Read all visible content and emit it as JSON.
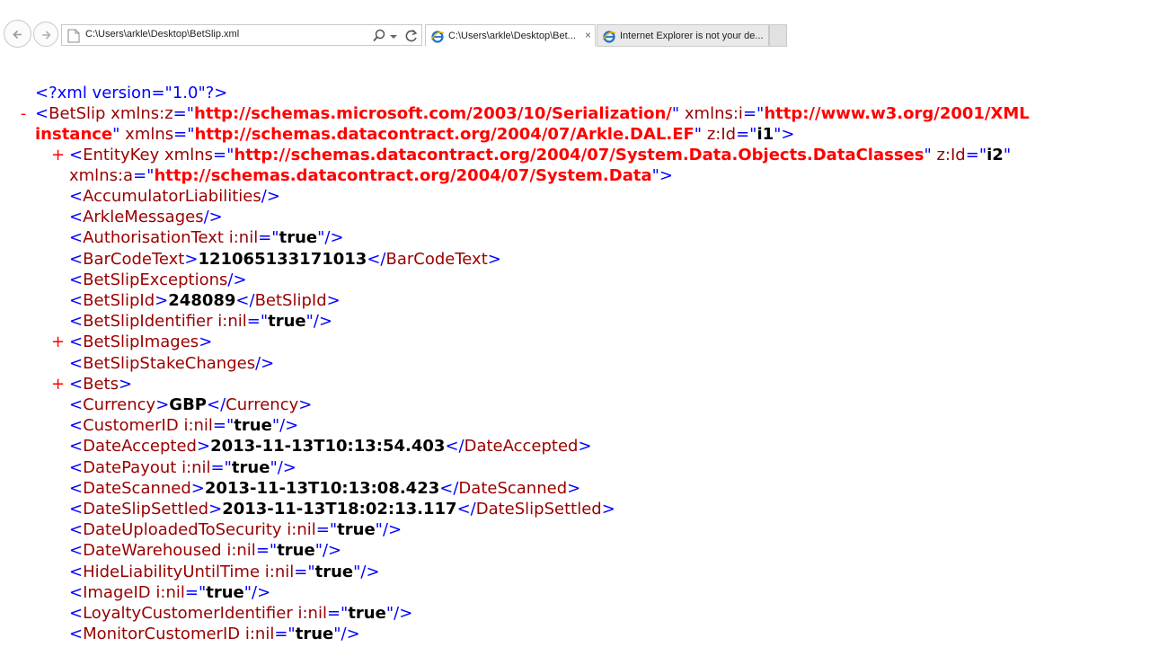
{
  "browser": {
    "address_url": "C:\\Users\\arkle\\Desktop\\BetSlip.xml",
    "tabs": [
      {
        "label": "C:\\Users\\arkle\\Desktop\\Bet...",
        "active": true
      },
      {
        "label": "Internet Explorer is not your de...",
        "active": false
      }
    ],
    "close_glyph": "×"
  },
  "xml": {
    "declaration": "<?xml version=\"1.0\"?>",
    "root": {
      "marker": "-",
      "name": "BetSlip",
      "attr1_name": "xmlns:z",
      "attr1_value": "http://schemas.microsoft.com/2003/10/Serialization/",
      "attr2_name": "xmlns:i",
      "attr2_value_a": "http://www.w3.org/2001/XML",
      "attr2_value_b": "instance",
      "attr3_name": "xmlns",
      "attr3_value": "http://schemas.datacontract.org/2004/07/Arkle.DAL.EF",
      "attr4_name": "z:Id",
      "attr4_value": "i1"
    },
    "entity_key": {
      "marker": "+",
      "name": "EntityKey",
      "attr1_name": "xmlns",
      "attr1_value": "http://schemas.datacontract.org/2004/07/System.Data.Objects.DataClasses",
      "attr2_name": "z:Id",
      "attr2_value": "i2",
      "attr3_name": "xmlns:a",
      "attr3_value": "http://schemas.datacontract.org/2004/07/System.Data"
    },
    "lines": [
      {
        "kind": "empty",
        "name": "AccumulatorLiabilities"
      },
      {
        "kind": "empty",
        "name": "ArkleMessages"
      },
      {
        "kind": "nil",
        "name": "AuthorisationText",
        "attr": "i:nil",
        "value": "true"
      },
      {
        "kind": "text",
        "name": "BarCodeText",
        "value": "121065133171013"
      },
      {
        "kind": "empty",
        "name": "BetSlipExceptions"
      },
      {
        "kind": "text",
        "name": "BetSlipId",
        "value": "248089"
      },
      {
        "kind": "nil",
        "name": "BetSlipIdentifier",
        "attr": "i:nil",
        "value": "true"
      },
      {
        "kind": "collapsed",
        "marker": "+",
        "name": "BetSlipImages"
      },
      {
        "kind": "empty",
        "name": "BetSlipStakeChanges"
      },
      {
        "kind": "collapsed",
        "marker": "+",
        "name": "Bets"
      },
      {
        "kind": "text",
        "name": "Currency",
        "value": "GBP"
      },
      {
        "kind": "nil",
        "name": "CustomerID",
        "attr": "i:nil",
        "value": "true"
      },
      {
        "kind": "text",
        "name": "DateAccepted",
        "value": "2013-11-13T10:13:54.403"
      },
      {
        "kind": "nil",
        "name": "DatePayout",
        "attr": "i:nil",
        "value": "true"
      },
      {
        "kind": "text",
        "name": "DateScanned",
        "value": "2013-11-13T10:13:08.423"
      },
      {
        "kind": "text",
        "name": "DateSlipSettled",
        "value": "2013-11-13T18:02:13.117"
      },
      {
        "kind": "nil",
        "name": "DateUploadedToSecurity",
        "attr": "i:nil",
        "value": "true"
      },
      {
        "kind": "nil",
        "name": "DateWarehoused",
        "attr": "i:nil",
        "value": "true"
      },
      {
        "kind": "nil",
        "name": "HideLiabilityUntilTime",
        "attr": "i:nil",
        "value": "true"
      },
      {
        "kind": "nil",
        "name": "ImageID",
        "attr": "i:nil",
        "value": "true"
      },
      {
        "kind": "nil",
        "name": "LoyaltyCustomerIdentifier",
        "attr": "i:nil",
        "value": "true"
      },
      {
        "kind": "nil",
        "name": "MonitorCustomerID",
        "attr": "i:nil",
        "value": "true"
      }
    ]
  },
  "colors": {
    "markup": "#0000ff",
    "element_name": "#990000",
    "attribute_value": "#ff0000",
    "text_value": "#000000"
  }
}
